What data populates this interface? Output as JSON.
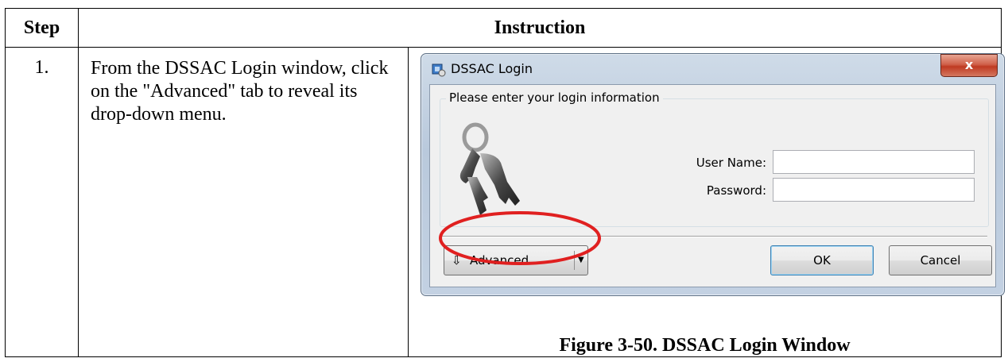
{
  "table": {
    "header_step": "Step",
    "header_instruction": "Instruction",
    "rows": [
      {
        "step": "1.",
        "instruction": "From the DSSAC Login window, click on the \"Advanced\" tab to reveal its drop-down menu."
      }
    ]
  },
  "dialog": {
    "title": "DSSAC Login",
    "close_label": "x",
    "group_legend": "Please enter your login information",
    "username_label": "User Name:",
    "username_value": "",
    "password_label": "Password:",
    "password_value": "",
    "advanced_label": "Advanced",
    "ok_label": "OK",
    "cancel_label": "Cancel",
    "advanced_icon": "down-arrow-icon",
    "keys_image": "keys-icon",
    "highlight_color": "#e02020"
  },
  "figure_caption": "Figure 3-50.  DSSAC Login Window"
}
